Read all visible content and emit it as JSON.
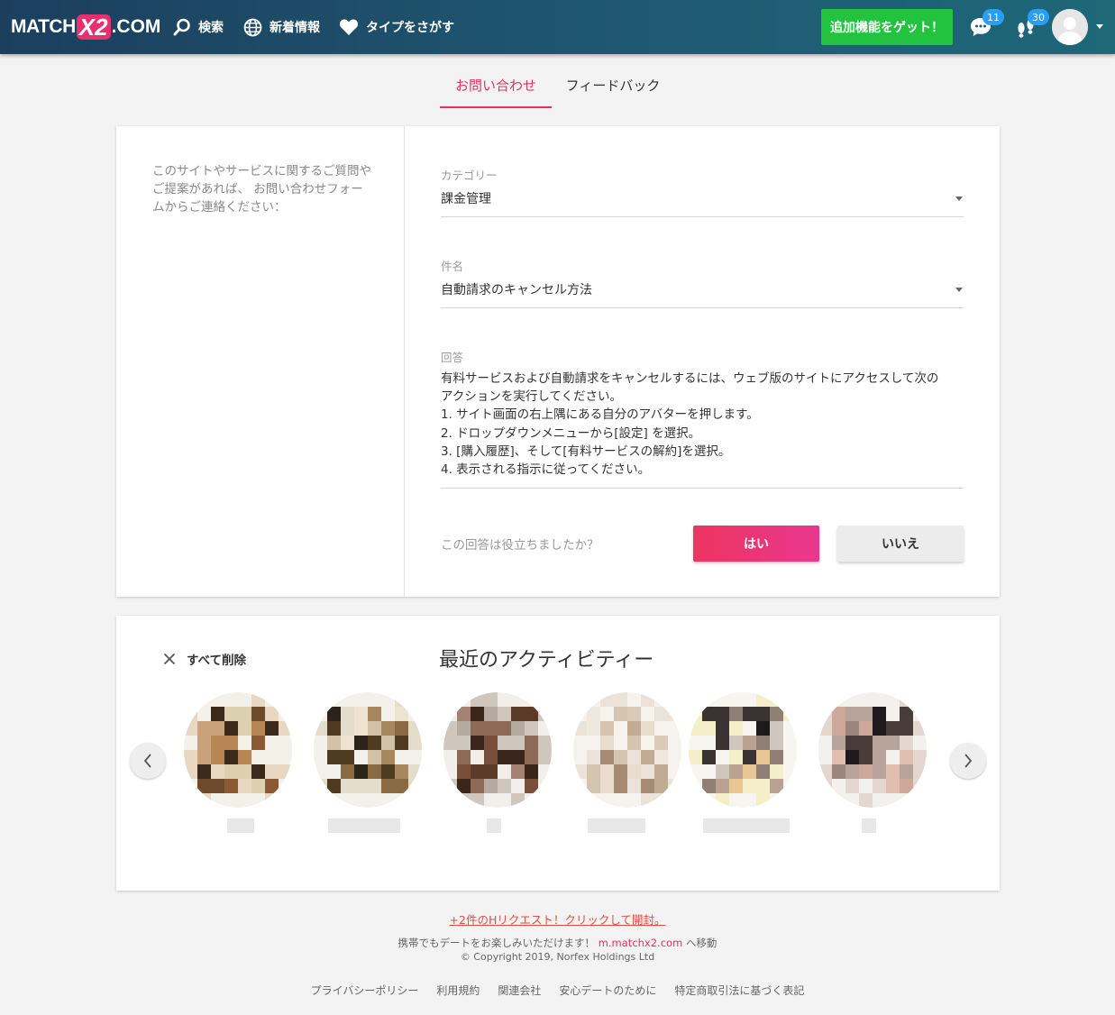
{
  "header": {
    "logo": {
      "part1": "MATCH",
      "part2": "X2",
      "part3": ".COM"
    },
    "nav": [
      {
        "label": "検索",
        "icon": "search-icon"
      },
      {
        "label": "新着情報",
        "icon": "globe-icon"
      },
      {
        "label": "タイプをさがす",
        "icon": "heart-icon"
      }
    ],
    "get_features_label": "追加機能をゲット！",
    "messages_count": "11",
    "footprints_count": "30"
  },
  "tabs": [
    {
      "label": "お問い合わせ",
      "active": true
    },
    {
      "label": "フィードバック",
      "active": false
    }
  ],
  "form": {
    "intro": "このサイトやサービスに関するご質問やご提案があれば、 お問い合わせフォームからご連絡ください：",
    "category_label": "カテゴリー",
    "category_value": "課金管理",
    "subject_label": "件名",
    "subject_value": "自動請求のキャンセル方法",
    "answer_label": "回答",
    "answer_lines": [
      "有料サービスおよび自動請求をキャンセルするには、ウェブ版のサイトにアクセスして次の",
      "アクションを実行してください。",
      "1. サイト画面の右上隅にある自分のアバターを押します。",
      "2. ドロップダウンメニューから[設定] を選択。",
      "3. [購入履歴]、そして[有料サービスの解約]を選択。",
      "4. 表示される指示に従ってください。"
    ],
    "helpful_question": "この回答は役立ちましたか？",
    "yes_label": "はい",
    "no_label": "いいえ"
  },
  "activity": {
    "clear_all_label": "すべて削除",
    "title": "最近のアクティビティー"
  },
  "footer": {
    "request_link": "+2件のHリクエスト！クリックして開封。",
    "mobile_text": "携帯でもデートをお楽しみいただけます！",
    "mobile_link": "m.matchx2.com",
    "mobile_suffix": "へ移動",
    "copyright": "© Copyright 2019, Norfex Holdings Ltd",
    "links": [
      "プライバシーポリシー",
      "利用規約",
      "関連会社",
      "安心デートのために",
      "特定商取引法に基づく表記"
    ]
  },
  "colors": {
    "accent": "#e6315d",
    "header_start": "#1c3f5e",
    "header_end": "#1e6878",
    "cta_green": "#21c33f",
    "badge_blue": "#2a9df4"
  }
}
